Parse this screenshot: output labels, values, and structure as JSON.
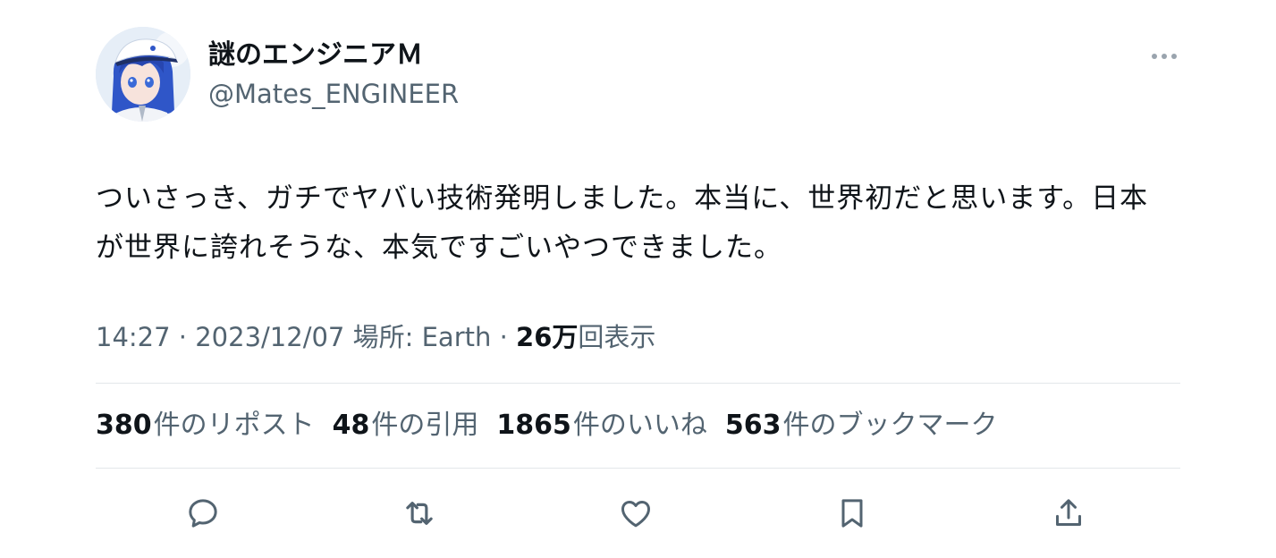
{
  "author": {
    "display_name": "謎のエンジニアＭ",
    "handle": "@Mates_ENGINEER"
  },
  "tweet": {
    "text": "ついさっき、ガチでヤバい技術発明しました。本当に、世界初だと思います。日本が世界に誇れそうな、本気ですごいやつできました。"
  },
  "meta": {
    "time": "14:27",
    "sep1": " · ",
    "date": "2023/12/07",
    "location_label": "場所: Earth",
    "sep2": " · ",
    "views_count": "26万",
    "views_label": "回表示"
  },
  "stats": {
    "reposts_count": "380",
    "reposts_label": "件のリポスト",
    "quotes_count": "48",
    "quotes_label": "件の引用",
    "likes_count": "1865",
    "likes_label": "件のいいね",
    "bookmarks_count": "563",
    "bookmarks_label": "件のブックマーク"
  },
  "actions": {
    "reply_icon": "reply-icon",
    "repost_icon": "repost-icon",
    "like_icon": "heart-icon",
    "bookmark_icon": "bookmark-icon",
    "share_icon": "share-icon"
  },
  "colors": {
    "text": "#0f1419",
    "secondary": "#536471",
    "divider": "#e3e7ea"
  }
}
